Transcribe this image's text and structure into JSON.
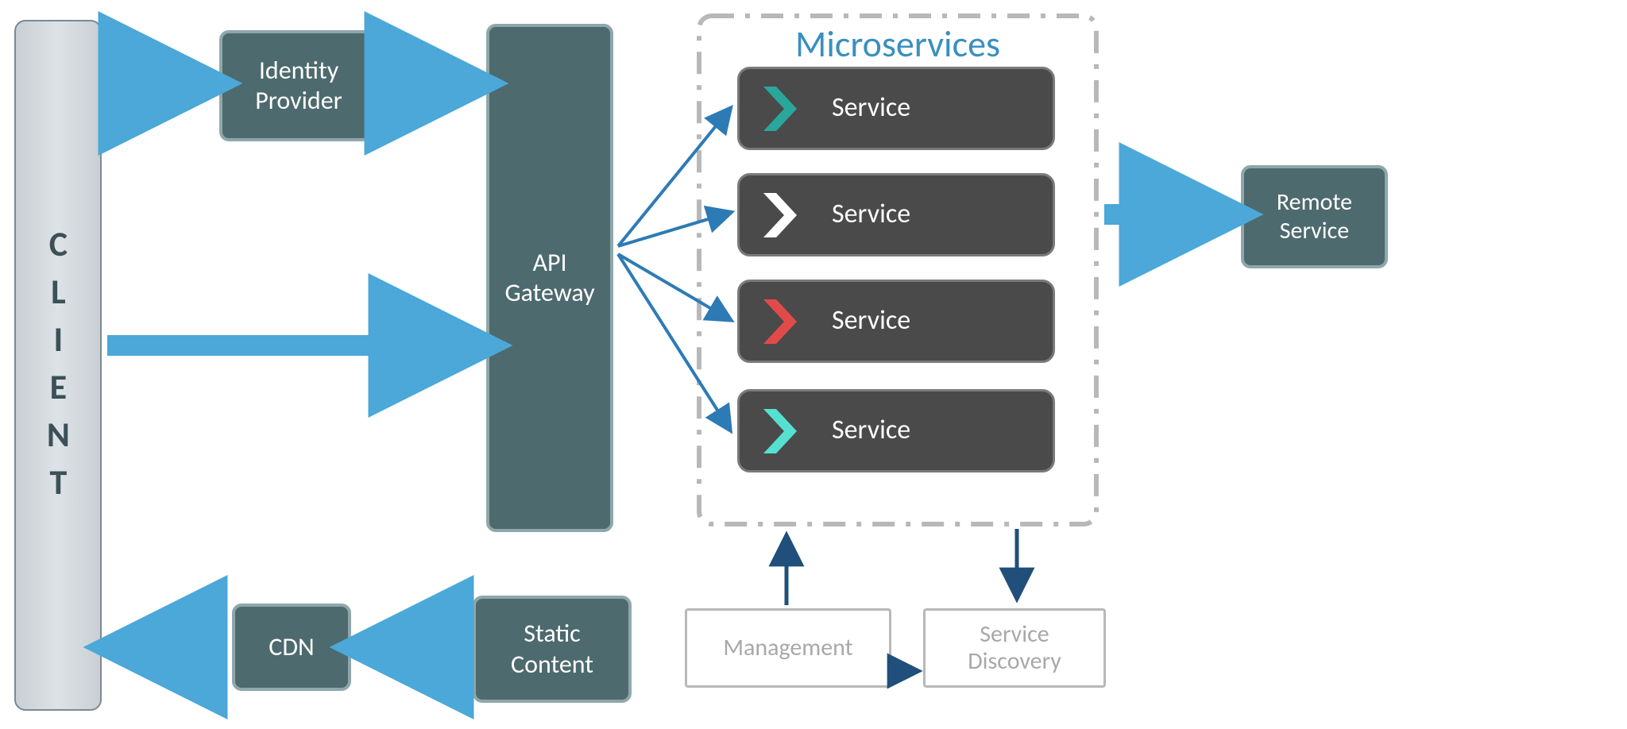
{
  "client": {
    "label": "CLIENT"
  },
  "identity_provider": {
    "label": "Identity\nProvider"
  },
  "api_gateway": {
    "label": "API\nGateway"
  },
  "cdn": {
    "label": "CDN"
  },
  "static_content": {
    "label": "Static\nContent"
  },
  "microservices": {
    "title": "Microservices",
    "services": [
      {
        "label": "Service",
        "chevron_color": "#2aa79b"
      },
      {
        "label": "Service",
        "chevron_color": "#ffffff"
      },
      {
        "label": "Service",
        "chevron_color": "#e24a4a"
      },
      {
        "label": "Service",
        "chevron_color": "#55e0d1"
      }
    ]
  },
  "remote_service": {
    "label": "Remote\nService"
  },
  "management": {
    "label": "Management"
  },
  "service_discovery": {
    "label": "Service\nDiscovery"
  },
  "colors": {
    "arrow_light": "#4ba8d8",
    "arrow_thin": "#2d7bb5",
    "arrow_dark": "#1f4f7a"
  }
}
